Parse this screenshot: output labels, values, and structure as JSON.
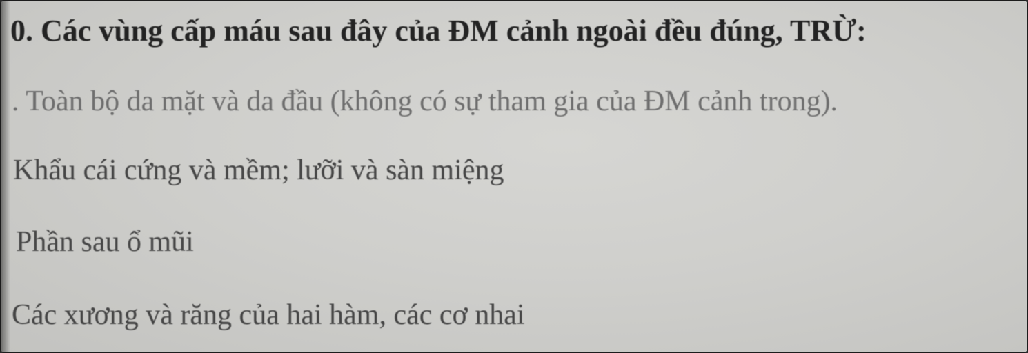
{
  "question": {
    "text": "0. Các vùng cấp máu sau đây của ĐM cảnh ngoài đều đúng, TRỪ:"
  },
  "options": [
    {
      "text": ". Toàn bộ da mặt và da đầu (không có sự tham gia của ĐM cảnh trong)."
    },
    {
      "text": "Khẩu cái cứng và mềm; lưỡi và sàn miệng"
    },
    {
      "text": "Phần sau ổ mũi"
    },
    {
      "text": "Các xương và răng của hai hàm, các cơ nhai"
    }
  ]
}
